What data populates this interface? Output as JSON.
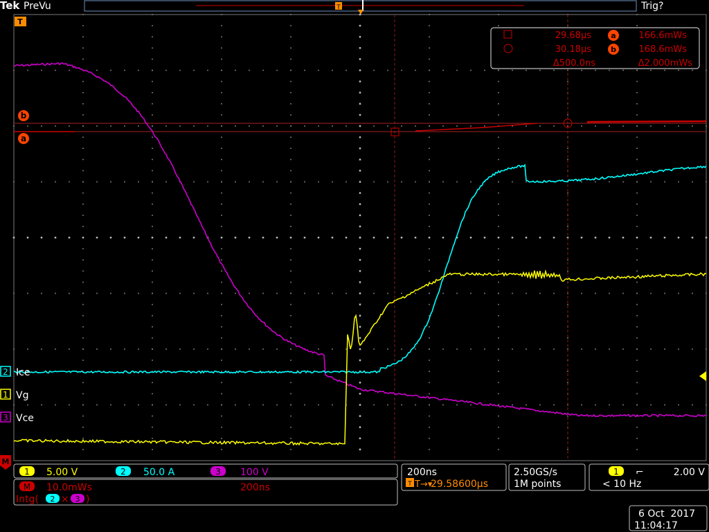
{
  "header": {
    "brand": "Tek",
    "mode": "PreVu",
    "trigger_status": "Trig?",
    "trigger_marker": "T"
  },
  "cursor_readout": {
    "a_time": "29.68µs",
    "a_value": "166.6mWs",
    "b_time": "30.18µs",
    "b_value": "168.6mWs",
    "delta_time": "Δ500.0ns",
    "delta_value": "Δ2.000mWs",
    "a_label": "a",
    "b_label": "b"
  },
  "channels": [
    {
      "num": "1",
      "name": "Vg",
      "scale": "5.00 V",
      "color": "#ffff00"
    },
    {
      "num": "2",
      "name": "Ice",
      "scale": "50.0 A",
      "color": "#00ffff"
    },
    {
      "num": "3",
      "name": "Vce",
      "scale": "100 V",
      "color": "#cc00cc"
    }
  ],
  "math": {
    "label": "M",
    "scale": "10.0mWs",
    "timebase": "200ns",
    "expression": "Intg(",
    "expression_ch_a": "2",
    "expression_op": "×",
    "expression_ch_b": "3",
    "expression_close": ")",
    "color": "#cc0000"
  },
  "horizontal": {
    "scale": "200ns",
    "position": "29.58600µs",
    "position_prefix": "T→▾"
  },
  "acquisition": {
    "sample_rate": "2.50GS/s",
    "record_length": "1M points"
  },
  "trigger": {
    "source": "1",
    "slope": "⌐",
    "level": "2.00 V",
    "frequency": "< 10 Hz"
  },
  "datetime": {
    "date": "6 Oct  2017",
    "time": "11:04:17"
  },
  "colors": {
    "ch1": "#ffff00",
    "ch2": "#00ffff",
    "ch3": "#cc00cc",
    "math": "#cc0000",
    "cursor": "#cc0000",
    "ui_orange": "#ff8c00",
    "grid": "#9a9a9a",
    "panel_border": "#bfbfbf"
  }
}
